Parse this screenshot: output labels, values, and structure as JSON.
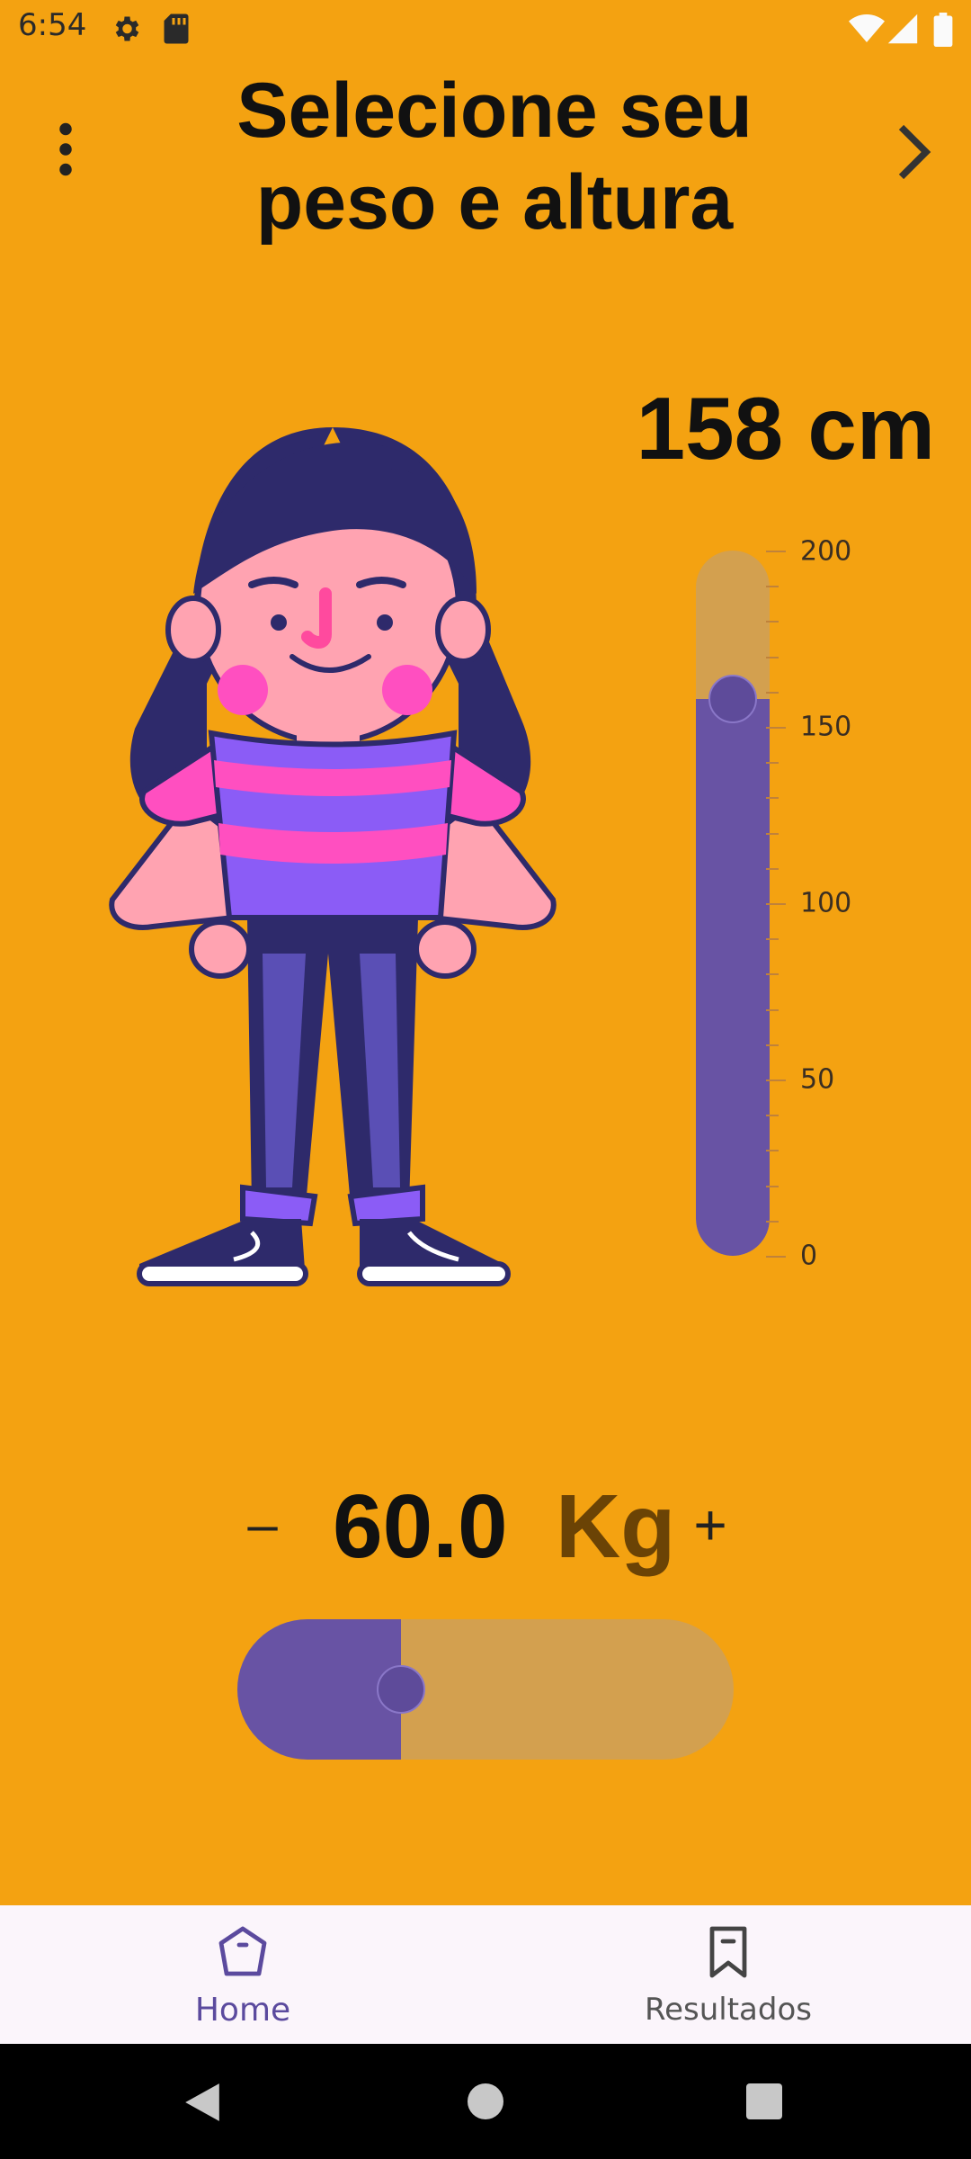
{
  "status_bar": {
    "time": "6:54",
    "icons": [
      "gear-icon",
      "sd-card-icon",
      "wifi-icon",
      "signal-icon",
      "battery-icon"
    ]
  },
  "header": {
    "title": "Selecione seu peso e altura",
    "menu_icon": "more-vertical-icon",
    "next_icon": "chevron-right-icon"
  },
  "height": {
    "value_label": "158 cm",
    "value": 158,
    "min": 0,
    "max": 200,
    "scale_labels": [
      "200",
      "150",
      "100",
      "50",
      "0"
    ]
  },
  "weight": {
    "minus_label": "–",
    "value": "60.0",
    "unit": "Kg",
    "plus_label": "+",
    "slider_fraction": 0.33
  },
  "bottom_nav": {
    "items": [
      {
        "label": "Home",
        "icon": "home-icon",
        "active": true
      },
      {
        "label": "Resultados",
        "icon": "bookmark-icon",
        "active": false
      }
    ]
  },
  "colors": {
    "background": "#F4A211",
    "accent": "#6853A4",
    "slider_track": "#D3A04F",
    "unit_text": "#6B4305"
  },
  "system_nav": {
    "icons": [
      "back-icon",
      "home-circle-icon",
      "recents-icon"
    ]
  }
}
